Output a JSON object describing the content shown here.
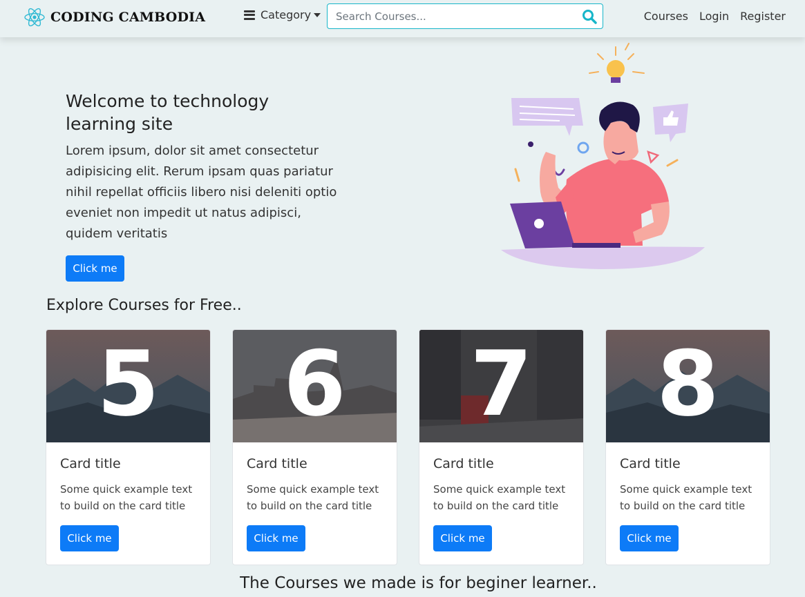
{
  "navbar": {
    "brand": "CODING CAMBODIA",
    "category_label": "Category",
    "search_placeholder": "Search Courses...",
    "links": [
      "Courses",
      "Login",
      "Register"
    ]
  },
  "hero": {
    "title": "Welcome to technology learning site",
    "text": "Lorem ipsum, dolor sit amet consectetur adipisicing elit. Rerum ipsam quas pariatur nihil repellat officiis libero nisi deleniti optio eveniet non impedit ut natus adipisci, quidem veritatis",
    "button": "Click me"
  },
  "courses": {
    "heading": "Explore Courses for Free..",
    "cards": [
      {
        "number": "5",
        "title": "Card title",
        "text": "Some quick example text to build on the card title and",
        "button": "Click me"
      },
      {
        "number": "6",
        "title": "Card title",
        "text": "Some quick example text to build on the card title and",
        "button": "Click me"
      },
      {
        "number": "7",
        "title": "Card title",
        "text": "Some quick example text to build on the card title and",
        "button": "Click me"
      },
      {
        "number": "8",
        "title": "Card title",
        "text": "Some quick example text to build on the card title and",
        "button": "Click me"
      }
    ]
  },
  "footer": {
    "heading": "The Courses we made is for beginer learner.."
  },
  "colors": {
    "background": "#e9f1f2",
    "primary_button": "#0d7bf7",
    "search_border": "#17b6c9",
    "search_icon": "#17b6c9"
  },
  "icons": [
    "react-logo-icon",
    "bars-icon",
    "caret-down-icon",
    "search-icon"
  ]
}
